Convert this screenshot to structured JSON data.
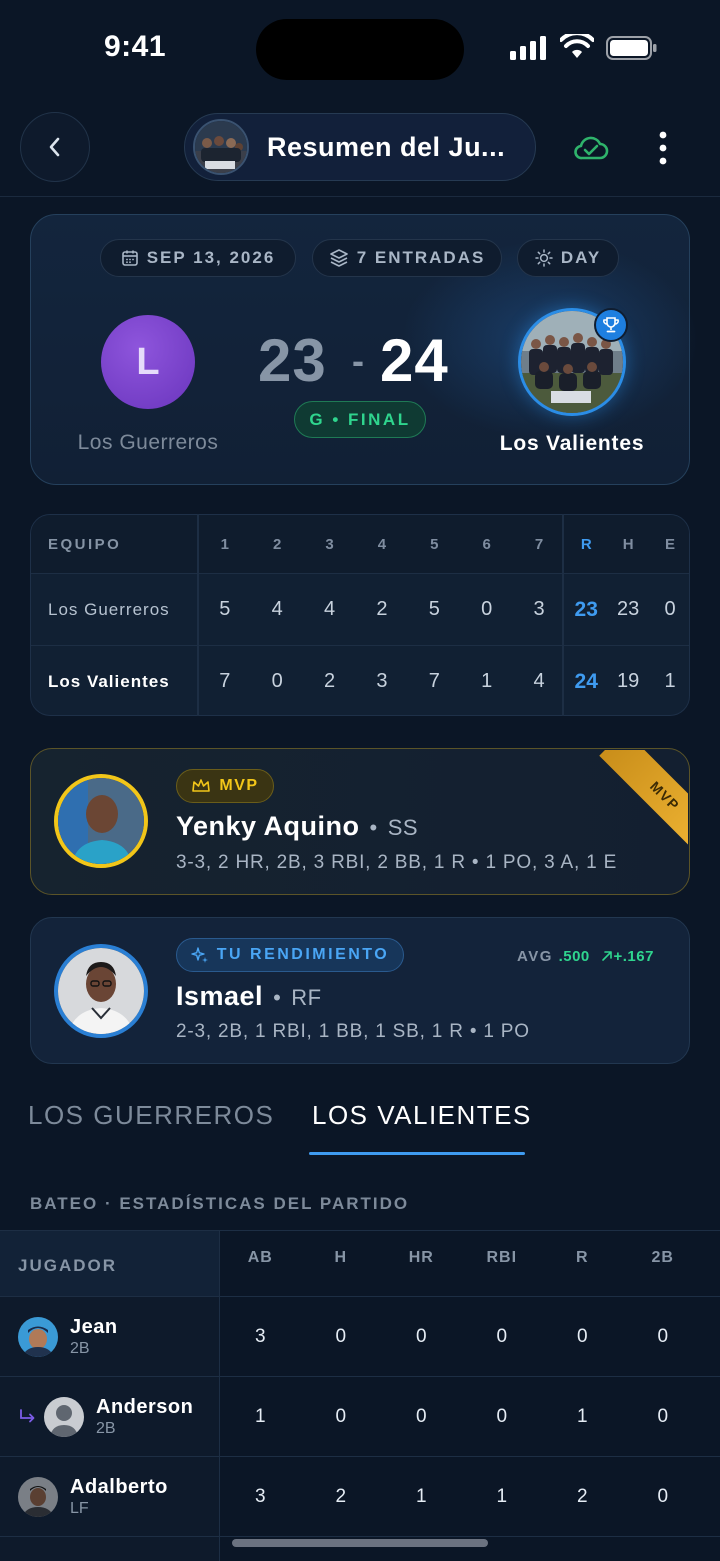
{
  "status_bar": {
    "time": "9:41"
  },
  "header": {
    "title": "Resumen del Ju...",
    "back_icon": "chevron-left-icon",
    "sync_icon": "cloud-check-icon",
    "more_icon": "more-vertical-icon"
  },
  "game": {
    "chips": [
      {
        "icon": "calendar-icon",
        "label": "SEP 13, 2026"
      },
      {
        "icon": "layers-icon",
        "label": "7 ENTRADAS"
      },
      {
        "icon": "sun-icon",
        "label": "DAY"
      }
    ],
    "away": {
      "initial": "L",
      "name": "Los Guerreros",
      "score": "23"
    },
    "home": {
      "name": "Los Valientes",
      "score": "24",
      "winner_icon": "trophy-icon"
    },
    "separator": "-",
    "status": "G • FINAL"
  },
  "line_score": {
    "header": [
      "EQUIPO",
      "1",
      "2",
      "3",
      "4",
      "5",
      "6",
      "7",
      "R",
      "H",
      "E"
    ],
    "rows": [
      {
        "team": "Los Guerreros",
        "innings": [
          "5",
          "4",
          "4",
          "2",
          "5",
          "0",
          "3"
        ],
        "r": "23",
        "h": "23",
        "e": "0"
      },
      {
        "team": "Los Valientes",
        "innings": [
          "7",
          "0",
          "2",
          "3",
          "7",
          "1",
          "4"
        ],
        "r": "24",
        "h": "19",
        "e": "1"
      }
    ]
  },
  "mvp": {
    "badge": "MVP",
    "ribbon": "MVP",
    "name": "Yenky Aquino",
    "position": "SS",
    "stats": "3-3, 2 HR, 2B, 3 RBI, 2 BB, 1 R • 1 PO, 3 A, 1 E",
    "accent": "#f2c619"
  },
  "my_performance": {
    "badge": "TU RENDIMIENTO",
    "avg_label": "AVG",
    "avg_value": ".500",
    "avg_delta": "+.167",
    "name": "Ismael",
    "position": "RF",
    "stats": "2-3, 2B, 1 RBI, 1 BB, 1 SB, 1 R • 1 PO"
  },
  "tabs": [
    {
      "label": "LOS GUERREROS",
      "active": false
    },
    {
      "label": "LOS VALIENTES",
      "active": true
    }
  ],
  "batting": {
    "section_title": "BATEO · ESTADÍSTICAS DEL PARTIDO",
    "columns": [
      "JUGADOR",
      "AB",
      "H",
      "HR",
      "RBI",
      "R",
      "2B"
    ],
    "rows": [
      {
        "name": "Jean",
        "pos": "2B",
        "substitute": false,
        "stats": [
          "3",
          "0",
          "0",
          "0",
          "0",
          "0"
        ]
      },
      {
        "name": "Anderson",
        "pos": "2B",
        "substitute": true,
        "stats": [
          "1",
          "0",
          "0",
          "0",
          "1",
          "0"
        ]
      },
      {
        "name": "Adalberto",
        "pos": "LF",
        "substitute": false,
        "stats": [
          "3",
          "2",
          "1",
          "1",
          "2",
          "0"
        ]
      }
    ]
  },
  "colors": {
    "background": "#0b1626",
    "accent_blue": "#3f9bf0",
    "success_green": "#2fd58e",
    "mvp_gold": "#f2c619",
    "team_purple": "#7b45cc"
  }
}
